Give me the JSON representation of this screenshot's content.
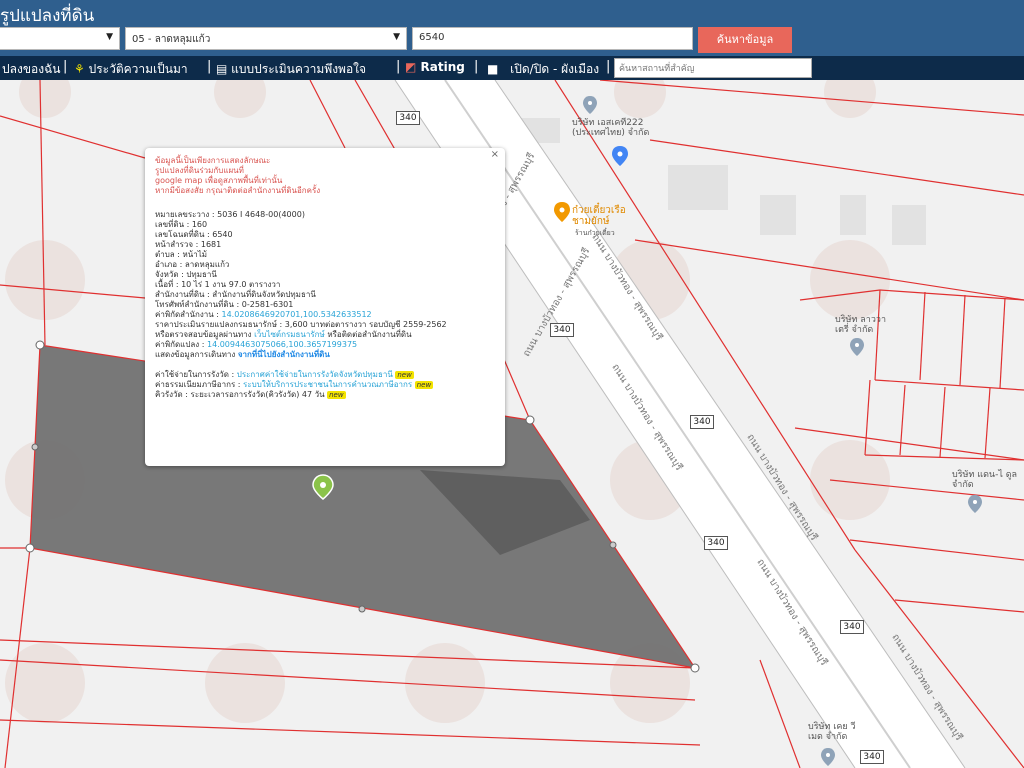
{
  "header": {
    "title": "รูปแปลงที่ดิน",
    "select1_value": "",
    "select2_value": "05 - ลาดหลุมแก้ว",
    "parcel_input_value": "6540",
    "search_button_label": "ค้นหาข้อมูล"
  },
  "menu": {
    "item1": "ปลงของฉัน",
    "item2": "ประวัติความเป็นมา",
    "item3": "แบบประเมินความพึงพอใจ",
    "item4": "Rating",
    "item5": "เปิด/ปิด - ผังเมือง",
    "search_placeholder": "ค้นหาสถานที่สำคัญ",
    "separator": "|"
  },
  "popup": {
    "close": "×",
    "warning": [
      "ข้อมูลนี้เป็นเพียงการแสดงลักษณะ",
      "รูปแปลงที่ดินร่วมกับแผนที่",
      "google map เพื่อดูสภาพพื้นที่เท่านั้น",
      "หากมีข้อสงสัย กรุณาติดต่อสำนักงานที่ดินอีกครั้ง"
    ],
    "fields": [
      {
        "label": "หมายเลขระวาง",
        "value": "5036 I 4648-00(4000)"
      },
      {
        "label": "เลขที่ดิน",
        "value": "160"
      },
      {
        "label": "เลขโฉนดที่ดิน",
        "value": "6540"
      },
      {
        "label": "หน้าสำรวจ",
        "value": "1681"
      },
      {
        "label": "ตำบล",
        "value": "หน้าไม้"
      },
      {
        "label": "อำเภอ",
        "value": "ลาดหลุมแก้ว"
      },
      {
        "label": "จังหวัด",
        "value": "ปทุมธานี"
      },
      {
        "label": "เนื้อที่",
        "value": "10 ไร่ 1 งาน 97.0 ตารางวา"
      },
      {
        "label": "สำนักงานที่ดิน",
        "value": "สำนักงานที่ดินจังหวัดปทุมธานี"
      },
      {
        "label": "โทรศัพท์สำนักงานที่ดิน",
        "value": "0-2581-6301"
      }
    ],
    "office_coord_label": "ค่าพิกัดสำนักงาน",
    "office_coord_value": "14.0208646920701,100.5342633512",
    "price_label": "ราคาประเมินรายแปลงกรมธนารักษ์",
    "price_value": "3,600 บาทต่อตารางวา รอบบัญชี 2559-2562",
    "check_prefix": "หรือตรวจสอบข้อมูลผ่านทาง",
    "check_link": "เว็บไซต์กรมธนารักษ์",
    "check_suffix": "หรือติดต่อสำนักงานที่ดิน",
    "parcel_coord_label": "ค่าพิกัดแปลง",
    "parcel_coord_value": "14.0094463075066,100.3657199375",
    "route_label": "แสดงข้อมูลการเดินทาง",
    "route_link": "จากที่นี่ไปยังสำนักงานที่ดิน",
    "fee_label": "ค่าใช้จ่ายในการรังวัด",
    "fee_link": "ประกาศค่าใช้จ่ายในการรังวัดจังหวัดปทุมธานี",
    "tax_label": "ค่าธรรมเนียมภาษีอากร",
    "tax_link": "ระบบให้บริการประชาชนในการคำนวณภาษีอากร",
    "queue_label": "คิวรังวัด",
    "queue_value": "ระยะเวลารอการรังวัด(คิวรังวัด) 47 วัน",
    "new_badge": "new"
  },
  "map": {
    "road_name": "ถนน บางบัวทอง - สุพรรณบุรี",
    "route_number": "340",
    "poi": [
      {
        "name": "บริษัท เอสเคที222 (ประเทศไทย) จำกัด"
      },
      {
        "name": "ก๋วยเตี๋ยวเรือชามยักษ์",
        "sub": "ร้านก๋วยเตี๋ยว"
      },
      {
        "name": "บริษัท ลาววา เตรี่ จำกัด"
      },
      {
        "name": "บริษัท แดน-ไ ดูล จำกัด"
      },
      {
        "name": "บริษัท เคย วีเมด จำกัด"
      }
    ],
    "colors": {
      "parcel_fill": "#6e6e6e",
      "boundary": "#e03030",
      "road": "#ffffff"
    }
  }
}
